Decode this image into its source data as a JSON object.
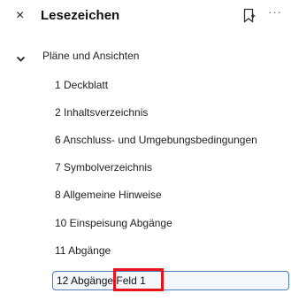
{
  "panel": {
    "close_glyph": "×",
    "title": "Lesezeichen",
    "more_glyph": "···"
  },
  "group": {
    "label": "Pläne und Ansichten"
  },
  "items": [
    {
      "label": "1 Deckblatt"
    },
    {
      "label": "2 Inhaltsverzeichnis"
    },
    {
      "label": "6 Anschluss- und Umgebungsbedingungen"
    },
    {
      "label": "7 Symbolverzeichnis"
    },
    {
      "label": "8 Allgemeine Hinweise"
    },
    {
      "label": "10 Einspeisung Abgänge"
    },
    {
      "label": "11 Abgänge"
    }
  ],
  "selected": {
    "label_prefix": "12 Abgänge",
    "label_suffix": "Feld 1"
  },
  "colors": {
    "selection_border": "#4a7fc1",
    "annotation_red": "#e8141b"
  }
}
